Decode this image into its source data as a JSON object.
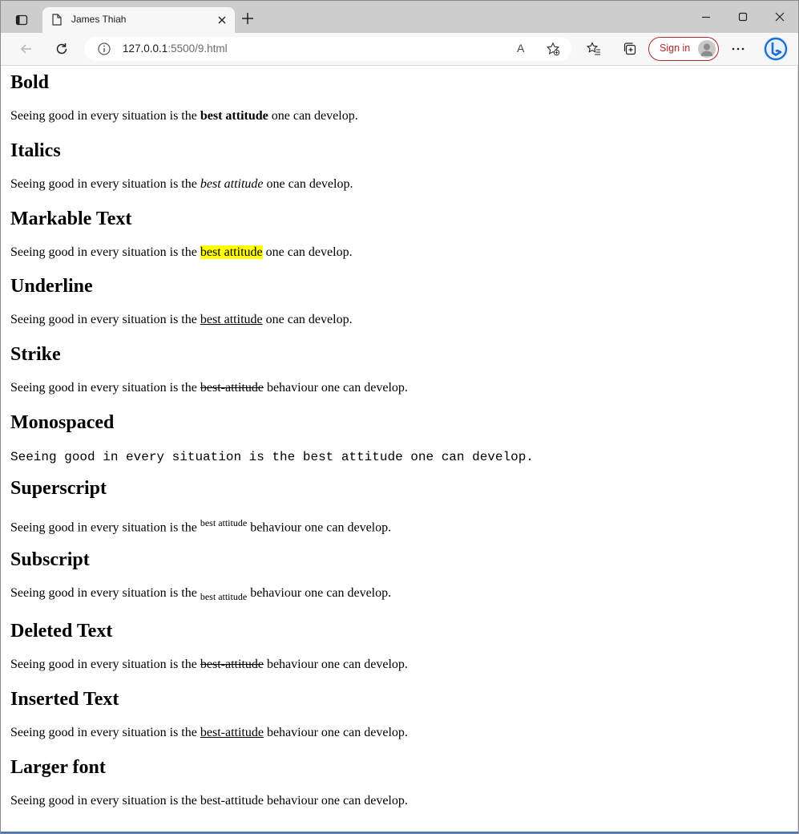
{
  "browser": {
    "tab_title": "James Thiah",
    "url_host": "127.0.0.1",
    "url_path": ":5500/9.html",
    "signin_label": "Sign in",
    "read_aloud_label": "A"
  },
  "prefix": "Seeing good in every situation is the ",
  "sections": {
    "bold": {
      "heading": "Bold",
      "highlight": "best attitude",
      "suffix": " one can develop."
    },
    "italics": {
      "heading": "Italics",
      "highlight": "best attitude",
      "suffix": " one can develop."
    },
    "markable": {
      "heading": "Markable Text",
      "highlight": "best attitude",
      "suffix": " one can develop."
    },
    "underline": {
      "heading": "Underline",
      "highlight": "best attitude",
      "suffix": " one can develop."
    },
    "strike": {
      "heading": "Strike",
      "highlight": "best-attitude",
      "suffix": " behaviour one can develop."
    },
    "monospaced": {
      "heading": "Monospaced",
      "text": "Seeing good in every situation is the best attitude one can develop."
    },
    "superscript": {
      "heading": "Superscript",
      "highlight": "best attitude",
      "suffix": " behaviour one can develop."
    },
    "subscript": {
      "heading": "Subscript",
      "highlight": "best attitude",
      "suffix": " behaviour one can develop."
    },
    "deleted": {
      "heading": "Deleted Text",
      "highlight": "best-attitude",
      "suffix": " behaviour one can develop."
    },
    "inserted": {
      "heading": "Inserted Text",
      "highlight": "best-attitude",
      "suffix": " behaviour one can develop."
    },
    "larger": {
      "heading": "Larger font",
      "text": "Seeing good in every situation is the best-attitude behaviour one can develop."
    }
  },
  "colors": {
    "mark": "#ffff00",
    "signin": "#b3262a",
    "bing_blue": "#1b6fd1"
  },
  "icons": [
    "tab-actions-icon",
    "page-icon",
    "close-icon",
    "plus-icon",
    "minimize-icon",
    "maximize-icon",
    "window-close-icon",
    "back-icon",
    "refresh-icon",
    "info-icon",
    "read-aloud-icon",
    "favorite-add-icon",
    "favorites-icon",
    "collections-icon",
    "avatar-icon",
    "more-icon",
    "bing-icon"
  ]
}
